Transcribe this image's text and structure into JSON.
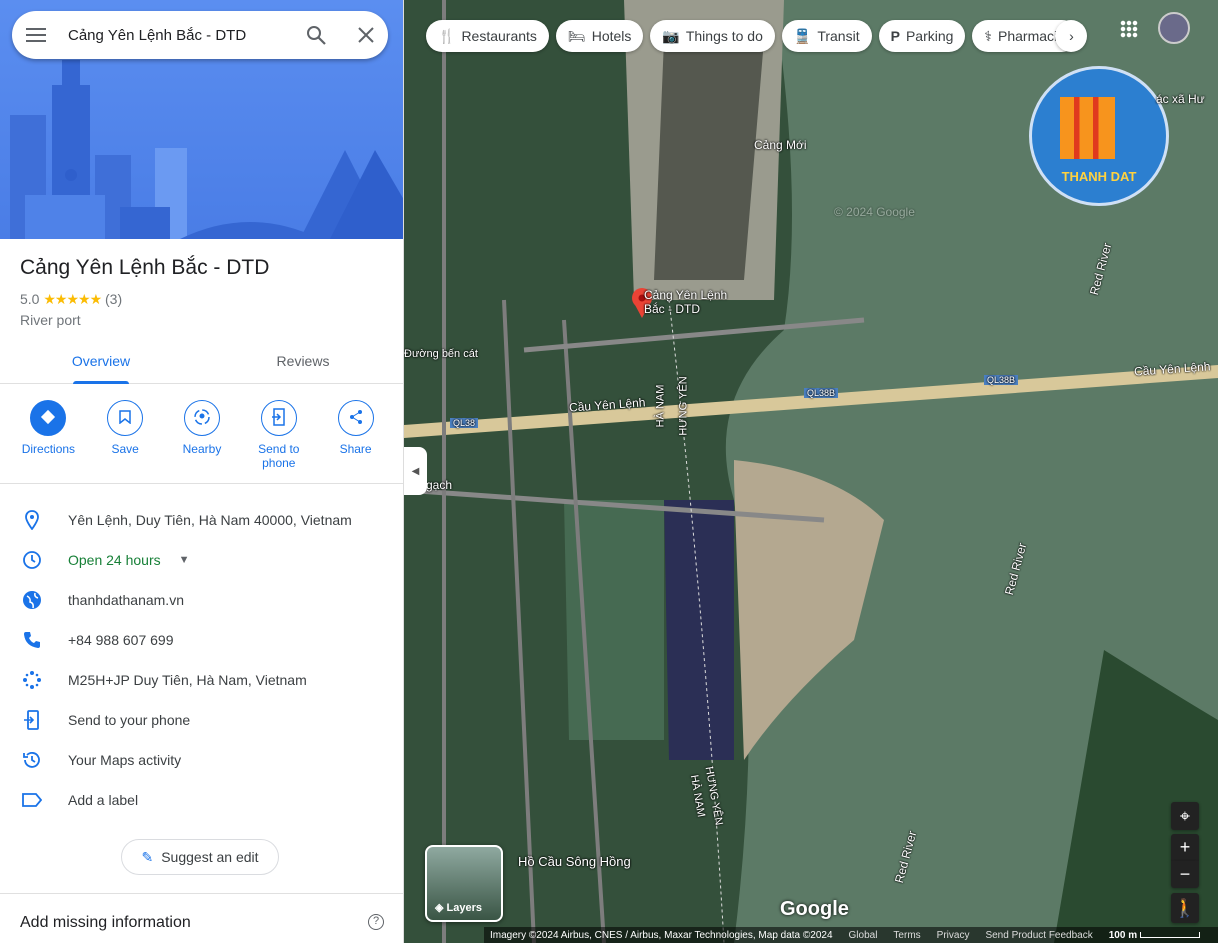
{
  "search": {
    "query": "Cảng Yên Lệnh Bắc - DTD"
  },
  "place": {
    "name": "Cảng Yên Lệnh Bắc - DTD",
    "rating": "5.0",
    "stars": "★★★★★",
    "reviews_count": "(3)",
    "category": "River port"
  },
  "tabs": [
    {
      "label": "Overview",
      "active": true
    },
    {
      "label": "Reviews",
      "active": false
    }
  ],
  "actions": [
    {
      "label": "Directions",
      "icon": "directions-icon"
    },
    {
      "label": "Save",
      "icon": "bookmark-icon"
    },
    {
      "label": "Nearby",
      "icon": "nearby-icon"
    },
    {
      "label": "Send to phone",
      "icon": "send-to-phone-icon"
    },
    {
      "label": "Share",
      "icon": "share-icon"
    }
  ],
  "info": [
    {
      "icon": "location-pin-icon",
      "text": "Yên Lệnh, Duy Tiên, Hà Nam 40000, Vietnam"
    },
    {
      "icon": "clock-icon",
      "text": "Open 24 hours"
    },
    {
      "icon": "globe-icon",
      "text": "thanhdathanam.vn"
    },
    {
      "icon": "phone-icon",
      "text": "+84 988 607 699"
    },
    {
      "icon": "plus-code-icon",
      "text": "M25H+JP Duy Tiên, Hà Nam, Vietnam"
    },
    {
      "icon": "send-to-phone-icon",
      "text": "Send to your phone"
    },
    {
      "icon": "history-icon",
      "text": "Your Maps activity"
    },
    {
      "icon": "label-icon",
      "text": "Add a label"
    }
  ],
  "suggest_edit": "Suggest an edit",
  "add_missing": "Add missing information",
  "chips": [
    {
      "label": "Restaurants",
      "icon": "🍴"
    },
    {
      "label": "Hotels",
      "icon": "🛏"
    },
    {
      "label": "Things to do",
      "icon": "📷"
    },
    {
      "label": "Transit",
      "icon": "🚆"
    },
    {
      "label": "Parking",
      "icon": "P"
    },
    {
      "label": "Pharmacies",
      "icon": "⚕"
    }
  ],
  "map": {
    "labels": {
      "pin": "Cảng Yên Lệnh Bắc - DTD",
      "cang_moi": "Cảng Mới",
      "bridge": "Cầu Yên Lệnh",
      "bridge2": "Cầu Yên Lệnh",
      "ql38": "QL38",
      "ql38b": "QL38B",
      "ql38b2": "QL38B",
      "ha_nam": "HÀ NAM",
      "hung_yen": "HƯNG YÊN",
      "hung_yen2": "HƯNG YÊN",
      "ha_nam2": "HÀ NAM",
      "red_river1": "Red River",
      "red_river2": "Red River",
      "red_river3": "Red River",
      "lake": "Hồ Cầu Sông Hồng",
      "bencat": "Đường bến cát",
      "gach": "h gạch",
      "xa": "ác xã Hư",
      "watermark": "© 2024 Google"
    },
    "logo_text": "THANH DAT",
    "layers": "Layers",
    "google": "Google",
    "footer": {
      "imagery": "Imagery ©2024 Airbus, CNES / Airbus, Maxar Technologies, Map data ©2024",
      "global": "Global",
      "terms": "Terms",
      "privacy": "Privacy",
      "feedback": "Send Product Feedback",
      "scale": "100 m"
    }
  },
  "colors": {
    "accent": "#1a73e8",
    "open": "#188038",
    "star": "#fbbc04",
    "pin": "#ea4335"
  }
}
